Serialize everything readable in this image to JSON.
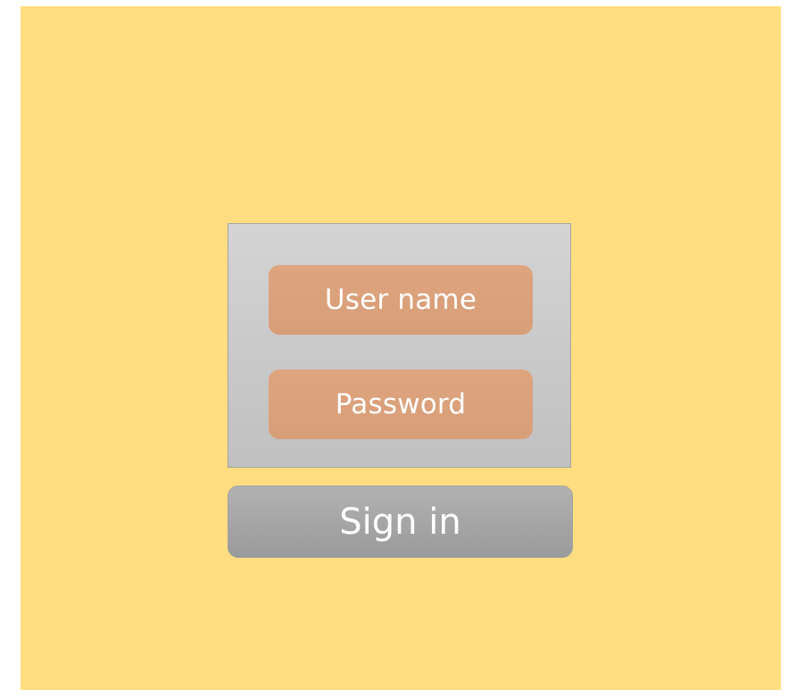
{
  "login": {
    "username_placeholder": "User name",
    "password_placeholder": "Password",
    "signin_label": "Sign in"
  },
  "colors": {
    "background": "#FFDD80",
    "panel": "#C8C8C8",
    "field": "#DBA17B",
    "button": "#A6A6A6",
    "text": "#FFFFFF"
  }
}
